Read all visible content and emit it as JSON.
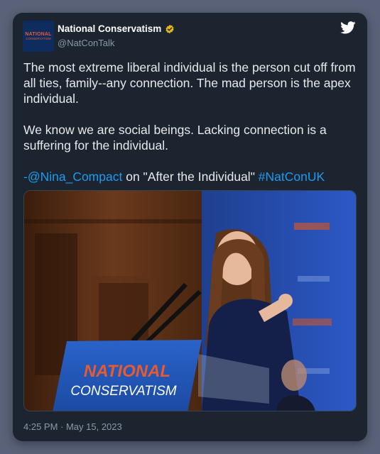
{
  "tweet": {
    "avatar_line1": "NATIONAL",
    "avatar_line2": "CONSERVATISM",
    "author_name": "National Conservatism",
    "handle": "@NatConTalk",
    "paragraph1": "The most extreme liberal individual is the person cut off from all ties, family--any connection. The mad person is the apex individual.",
    "paragraph2": "We know we are social beings. Lacking connection is a suffering for the individual.",
    "mention": "-@Nina_Compact",
    "mid_text": " on \"After the Individual\" ",
    "hashtag": "#NatConUK",
    "podium_line1": "NATIONAL",
    "podium_line2": "CONSERVATISM",
    "timestamp": "4:25 PM · May 15, 2023"
  },
  "colors": {
    "background": "#5a6279",
    "card": "#1c2430",
    "link": "#1d9bf0",
    "verified_gold": "#e2b719",
    "brand_orange": "#e85b2f",
    "podium_blue": "#1f55b8"
  },
  "icons": {
    "verified": "verified-badge-icon",
    "platform": "twitter-bird-icon"
  }
}
